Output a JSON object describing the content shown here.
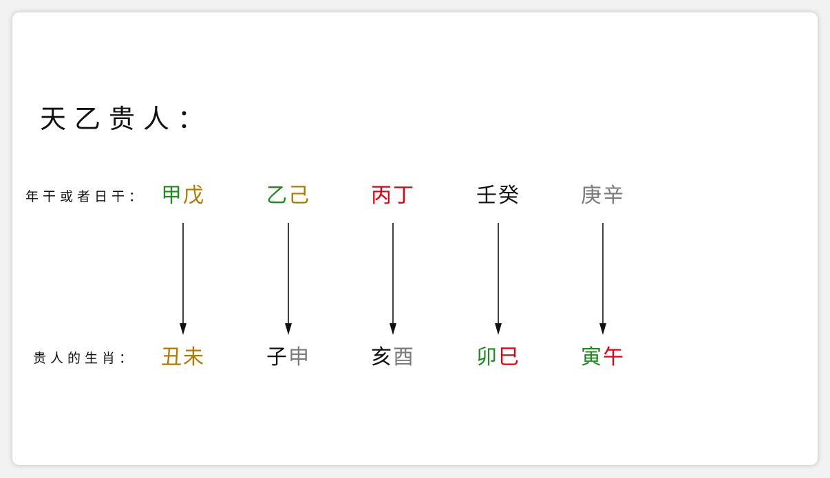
{
  "title": "天乙贵人：",
  "labels": {
    "top": "年干或者日干：",
    "bottom": "贵人的生肖："
  },
  "colors": {
    "green": "#1e8a1e",
    "gold": "#b07800",
    "red": "#e00010",
    "black": "#111111",
    "gray": "#7a7a7a"
  },
  "columns": [
    {
      "stems": [
        {
          "char": "甲",
          "color": "#1e8a1e"
        },
        {
          "char": "戊",
          "color": "#b07800"
        }
      ],
      "zodiac": [
        {
          "char": "丑",
          "color": "#b07800"
        },
        {
          "char": "未",
          "color": "#b07800"
        }
      ]
    },
    {
      "stems": [
        {
          "char": "乙",
          "color": "#1e8a1e"
        },
        {
          "char": "己",
          "color": "#b07800"
        }
      ],
      "zodiac": [
        {
          "char": "子",
          "color": "#111111"
        },
        {
          "char": "申",
          "color": "#7a7a7a"
        }
      ]
    },
    {
      "stems": [
        {
          "char": "丙",
          "color": "#e00010"
        },
        {
          "char": "丁",
          "color": "#e00010"
        }
      ],
      "zodiac": [
        {
          "char": "亥",
          "color": "#111111"
        },
        {
          "char": "酉",
          "color": "#7a7a7a"
        }
      ]
    },
    {
      "stems": [
        {
          "char": "壬",
          "color": "#111111"
        },
        {
          "char": "癸",
          "color": "#111111"
        }
      ],
      "zodiac": [
        {
          "char": "卯",
          "color": "#1e8a1e"
        },
        {
          "char": "巳",
          "color": "#e00010"
        }
      ]
    },
    {
      "stems": [
        {
          "char": "庚",
          "color": "#7a7a7a"
        },
        {
          "char": "辛",
          "color": "#7a7a7a"
        }
      ],
      "zodiac": [
        {
          "char": "寅",
          "color": "#1e8a1e"
        },
        {
          "char": "午",
          "color": "#e00010"
        }
      ]
    }
  ]
}
